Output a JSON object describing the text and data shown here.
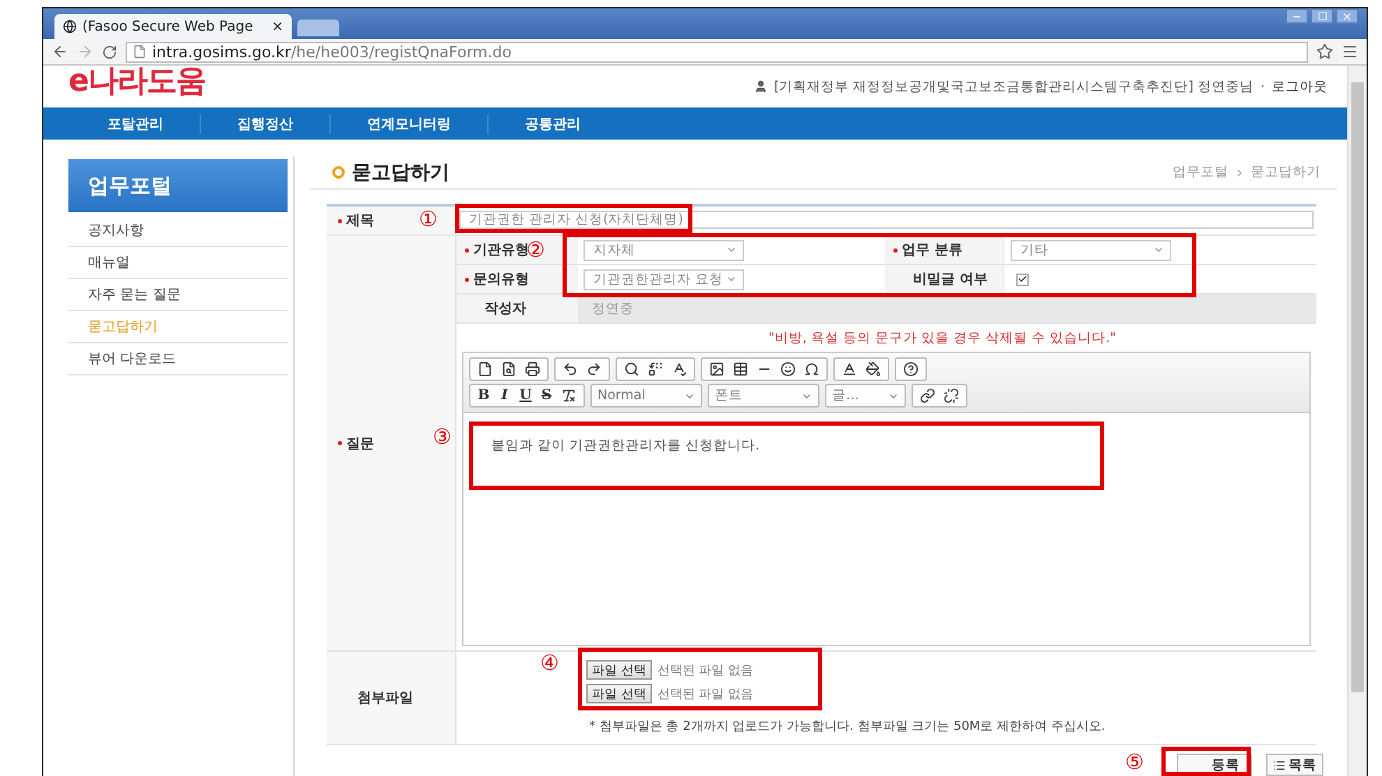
{
  "browser": {
    "tab_title": "(Fasoo Secure Web Page",
    "tab_close": "×",
    "url_host": "intra.gosims.go.kr",
    "url_path": "/he/he003/registQnaForm.do"
  },
  "header": {
    "logo": "e나라도움",
    "user_info": "[기획재정부 재정정보공개및국고보조금통합관리시스템구축추진단] 정연중님",
    "separator": "·",
    "logout": "로그아웃"
  },
  "nav": [
    "포탈관리",
    "집행정산",
    "연계모니터링",
    "공통관리"
  ],
  "sidebar": {
    "title": "업무포털",
    "items": [
      {
        "label": "공지사항",
        "selected": false
      },
      {
        "label": "매뉴얼",
        "selected": false
      },
      {
        "label": "자주 묻는 질문",
        "selected": false
      },
      {
        "label": "묻고답하기",
        "selected": true
      },
      {
        "label": "뷰어 다운로드",
        "selected": false
      }
    ]
  },
  "page_title": "묻고답하기",
  "breadcrumb": [
    "업무포털",
    "묻고답하기"
  ],
  "form": {
    "subject": {
      "label": "제목",
      "required": true,
      "value": "기관권한 관리자 신청(자치단체명)"
    },
    "org_type": {
      "label": "기관유형",
      "required": true,
      "value": "지자체"
    },
    "task_category": {
      "label": "업무 분류",
      "required": true,
      "value": "기타"
    },
    "inquiry_type": {
      "label": "문의유형",
      "required": true,
      "value": "기관권한관리자 요청"
    },
    "secret": {
      "label": "비밀글 여부",
      "required": false,
      "checked": true
    },
    "author": {
      "label": "작성자",
      "required": false,
      "value": "정연중"
    },
    "question": {
      "label": "질문",
      "required": true
    },
    "warning": "\"비방, 욕설 등의 문구가 있을 경우 삭제될 수 있습니다.\"",
    "format_buttons": [
      "B",
      "I",
      "U",
      "S"
    ],
    "dropdowns": [
      "Normal",
      "폰트",
      "글…"
    ],
    "body": "붙임과 같이 기관권한관리자를 신청합니다.",
    "attachments": {
      "label": "첨부파일",
      "files": [
        {
          "button": "파일 선택",
          "status": "선택된 파일 없음"
        },
        {
          "button": "파일 선택",
          "status": "선택된 파일 없음"
        }
      ],
      "note": "* 첨부파일은 총 2개까지 업로드가 가능합니다. 첨부파일 크기는 50M로 제한하여 주십시오."
    }
  },
  "buttons": [
    "등록",
    "목록"
  ],
  "annotations": [
    "①",
    "②",
    "③",
    "④",
    "⑤"
  ]
}
